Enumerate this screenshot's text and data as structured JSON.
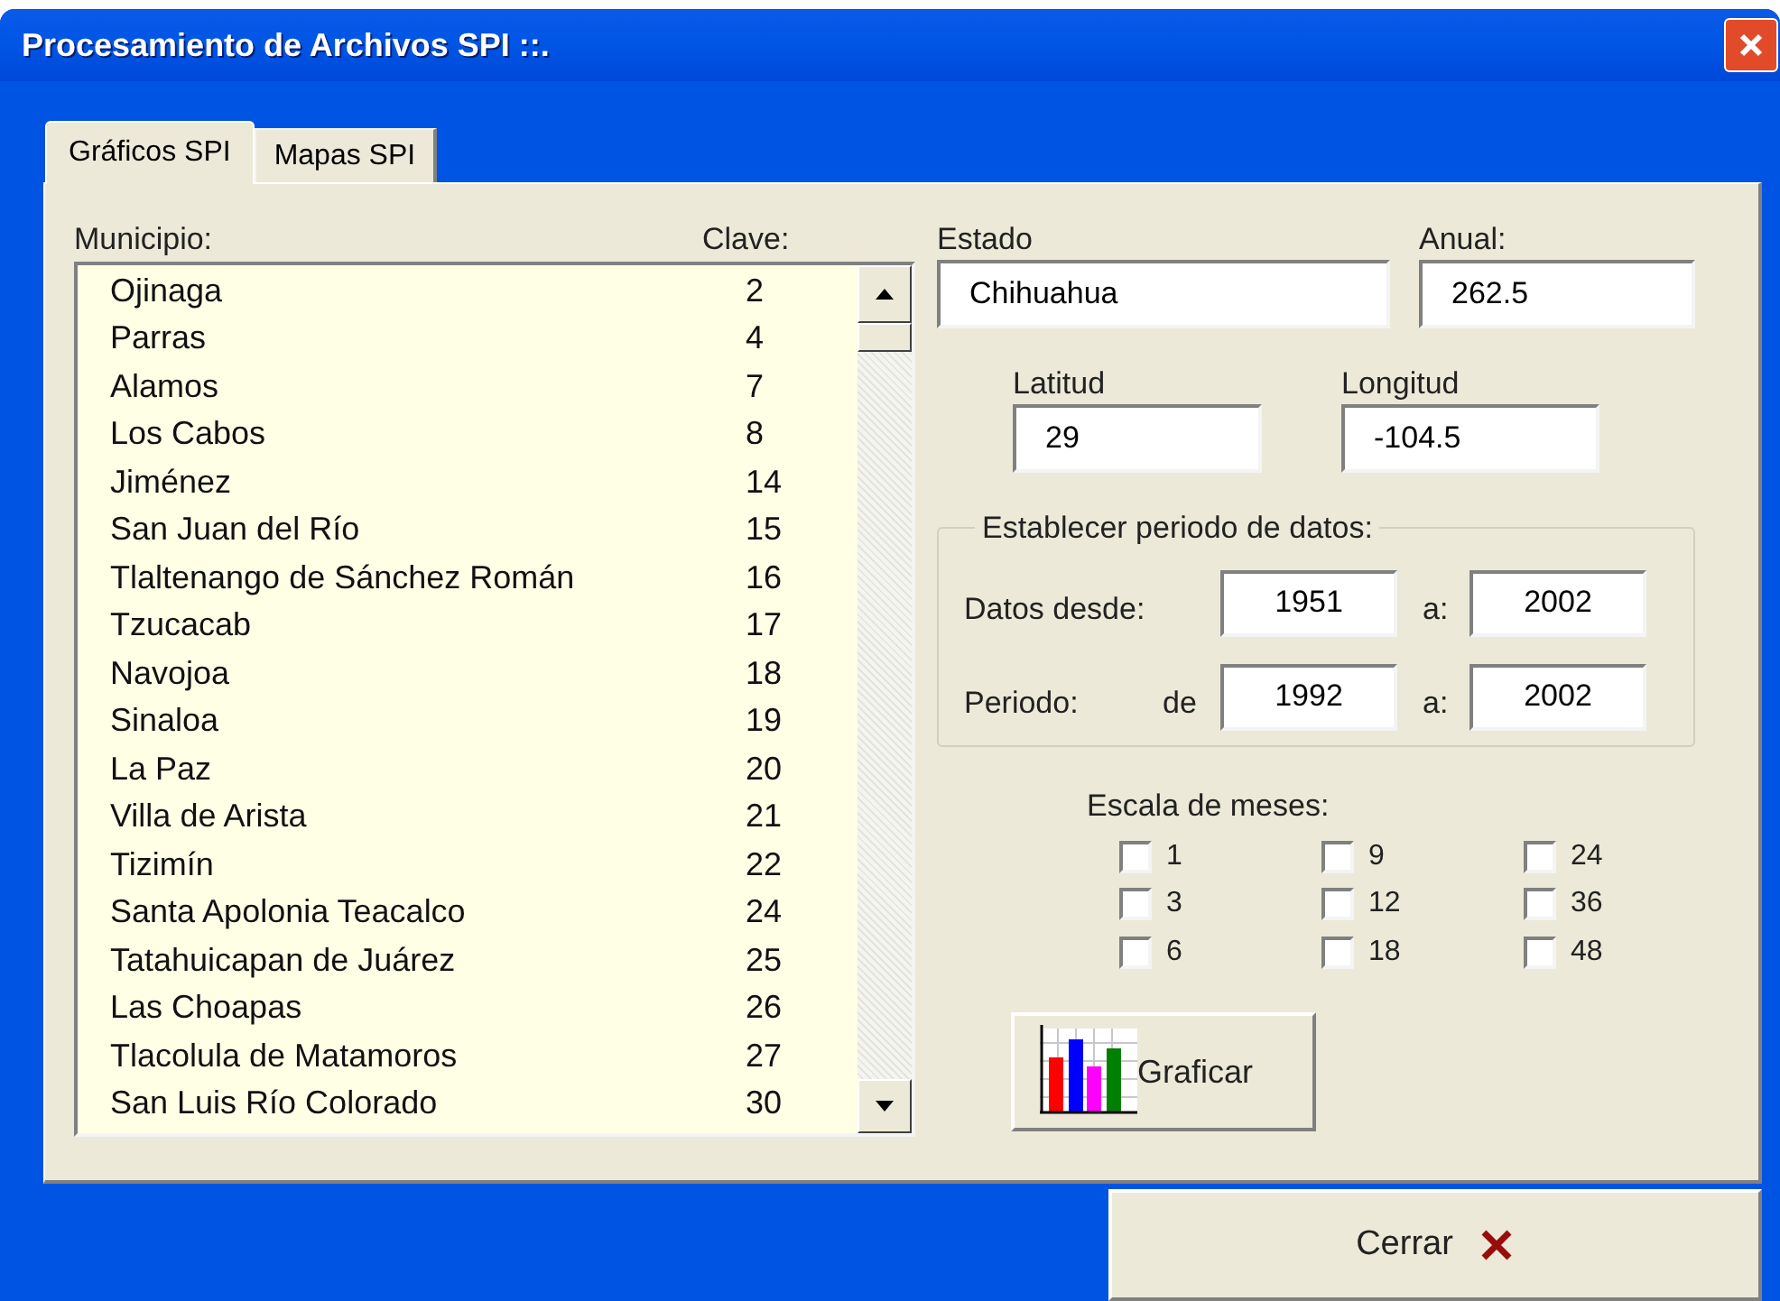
{
  "window": {
    "title": "Procesamiento de Archivos SPI ::."
  },
  "tabs": [
    {
      "label": "Gráficos SPI",
      "selected": true
    },
    {
      "label": "Mapas SPI",
      "selected": false
    }
  ],
  "list": {
    "name_header": "Municipio:",
    "code_header": "Clave:",
    "rows": [
      {
        "name": "Ojinaga",
        "code": "2"
      },
      {
        "name": "Parras",
        "code": "4"
      },
      {
        "name": "Alamos",
        "code": "7"
      },
      {
        "name": "Los Cabos",
        "code": "8"
      },
      {
        "name": "Jiménez",
        "code": "14"
      },
      {
        "name": "San Juan del Río",
        "code": "15"
      },
      {
        "name": "Tlaltenango de Sánchez Román",
        "code": "16"
      },
      {
        "name": "Tzucacab",
        "code": "17"
      },
      {
        "name": "Navojoa",
        "code": "18"
      },
      {
        "name": "Sinaloa",
        "code": "19"
      },
      {
        "name": "La Paz",
        "code": "20"
      },
      {
        "name": "Villa de Arista",
        "code": "21"
      },
      {
        "name": "Tizimín",
        "code": "22"
      },
      {
        "name": "Santa Apolonia Teacalco",
        "code": "24"
      },
      {
        "name": "Tatahuicapan de Juárez",
        "code": "25"
      },
      {
        "name": "Las Choapas",
        "code": "26"
      },
      {
        "name": "Tlacolula de Matamoros",
        "code": "27"
      },
      {
        "name": "San Luis Río Colorado",
        "code": "30"
      }
    ]
  },
  "estado": {
    "label": "Estado",
    "value": "Chihuahua"
  },
  "anual": {
    "label": "Anual:",
    "value": "262.5"
  },
  "latitud": {
    "label": "Latitud",
    "value": "29"
  },
  "longitud": {
    "label": "Longitud",
    "value": "-104.5"
  },
  "period": {
    "legend": "Establecer periodo de datos:",
    "from_label": "Datos desde:",
    "from": "1951",
    "from_to_label": "a:",
    "from_to": "2002",
    "period_label": "Periodo:",
    "period_de": "de",
    "period_from": "1992",
    "period_to_label": "a:",
    "period_to": "2002"
  },
  "scale": {
    "label": "Escala de meses:",
    "options": [
      {
        "label": "1",
        "checked": false
      },
      {
        "label": "3",
        "checked": false
      },
      {
        "label": "6",
        "checked": false
      },
      {
        "label": "9",
        "checked": false
      },
      {
        "label": "12",
        "checked": false
      },
      {
        "label": "18",
        "checked": false
      },
      {
        "label": "24",
        "checked": false
      },
      {
        "label": "36",
        "checked": false
      },
      {
        "label": "48",
        "checked": false
      }
    ]
  },
  "graph_button": "Graficar",
  "close_button": "Cerrar"
}
